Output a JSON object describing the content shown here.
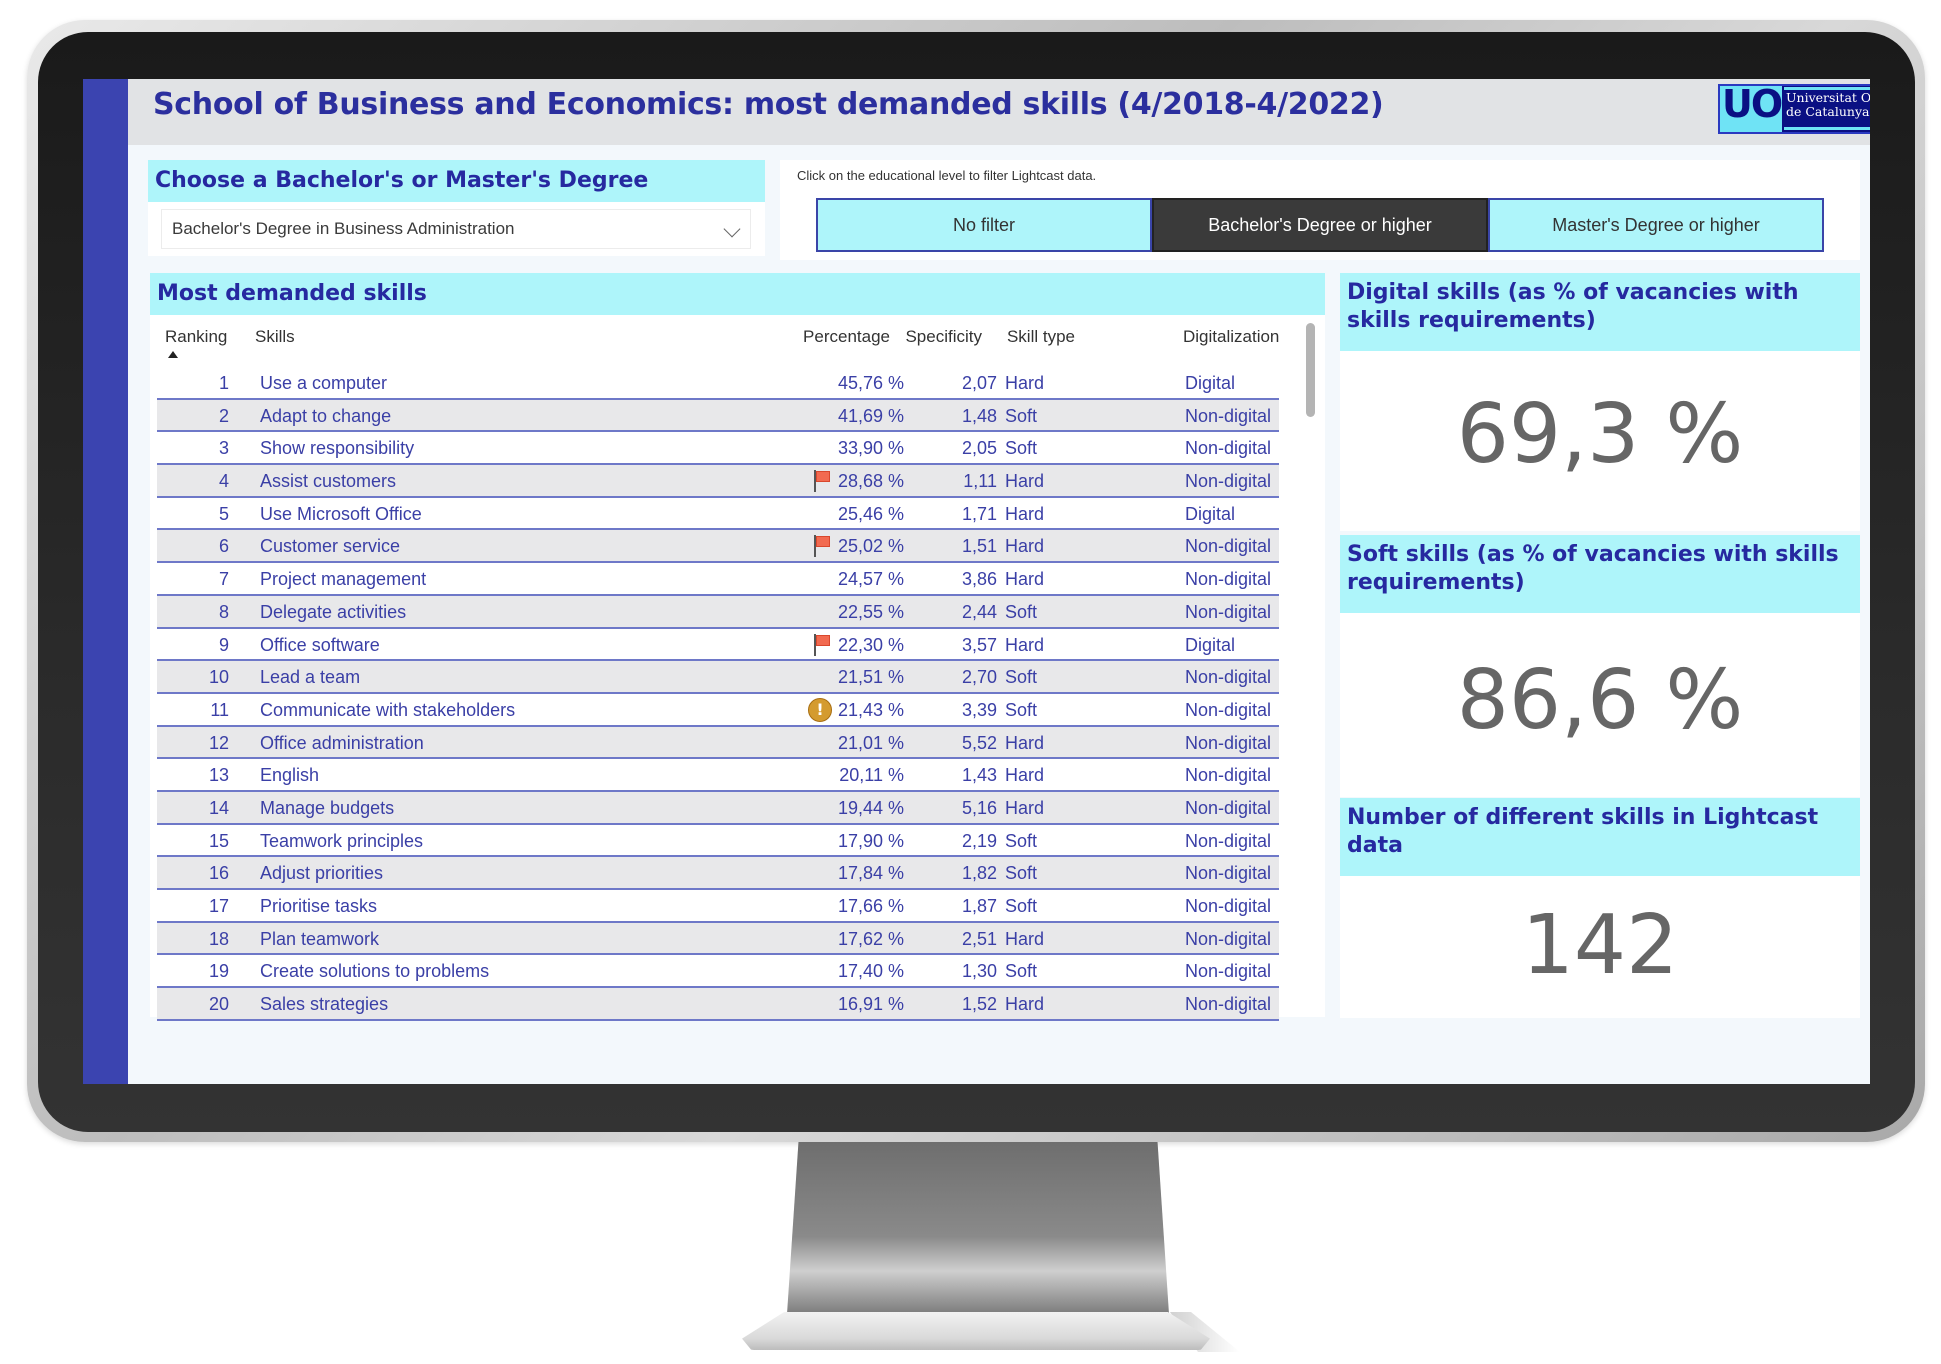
{
  "header": {
    "title": "School of Business and Economics: most demanded skills (4/2018-4/2022)",
    "logo": {
      "mark": "UOC",
      "line1": "Universitat Oberta",
      "line2": "de Catalunya"
    }
  },
  "degree_selector": {
    "heading": "Choose a Bachelor's or Master's Degree",
    "selected": "Bachelor's Degree in Business Administration"
  },
  "filter": {
    "hint": "Click on the educational level to filter Lightcast data.",
    "buttons": [
      {
        "label": "No filter",
        "active": false
      },
      {
        "label": "Bachelor's Degree or higher",
        "active": true
      },
      {
        "label": "Master's Degree or higher",
        "active": false
      }
    ]
  },
  "skills_table": {
    "heading": "Most demanded skills",
    "columns": {
      "ranking": "Ranking",
      "skills": "Skills",
      "percentage": "Percentage",
      "specificity": "Specificity",
      "skill_type": "Skill type",
      "digitalization": "Digitalization"
    },
    "sort": {
      "column": "Ranking",
      "direction": "ascending"
    },
    "rows": [
      {
        "rank": "1",
        "skill": "Use a computer",
        "marker": "",
        "percentage": "45,76 %",
        "specificity": "2,07",
        "type": "Hard",
        "digitalization": "Digital"
      },
      {
        "rank": "2",
        "skill": "Adapt to change",
        "marker": "",
        "percentage": "41,69 %",
        "specificity": "1,48",
        "type": "Soft",
        "digitalization": "Non-digital"
      },
      {
        "rank": "3",
        "skill": "Show responsibility",
        "marker": "",
        "percentage": "33,90 %",
        "specificity": "2,05",
        "type": "Soft",
        "digitalization": "Non-digital"
      },
      {
        "rank": "4",
        "skill": "Assist customers",
        "marker": "flag",
        "percentage": "28,68 %",
        "specificity": "1,11",
        "type": "Hard",
        "digitalization": "Non-digital"
      },
      {
        "rank": "5",
        "skill": "Use Microsoft Office",
        "marker": "",
        "percentage": "25,46 %",
        "specificity": "1,71",
        "type": "Hard",
        "digitalization": "Digital"
      },
      {
        "rank": "6",
        "skill": "Customer service",
        "marker": "flag",
        "percentage": "25,02 %",
        "specificity": "1,51",
        "type": "Hard",
        "digitalization": "Non-digital"
      },
      {
        "rank": "7",
        "skill": "Project management",
        "marker": "",
        "percentage": "24,57 %",
        "specificity": "3,86",
        "type": "Hard",
        "digitalization": "Non-digital"
      },
      {
        "rank": "8",
        "skill": "Delegate activities",
        "marker": "",
        "percentage": "22,55 %",
        "specificity": "2,44",
        "type": "Soft",
        "digitalization": "Non-digital"
      },
      {
        "rank": "9",
        "skill": "Office software",
        "marker": "flag",
        "percentage": "22,30 %",
        "specificity": "3,57",
        "type": "Hard",
        "digitalization": "Digital"
      },
      {
        "rank": "10",
        "skill": "Lead a team",
        "marker": "",
        "percentage": "21,51 %",
        "specificity": "2,70",
        "type": "Soft",
        "digitalization": "Non-digital"
      },
      {
        "rank": "11",
        "skill": "Communicate with stakeholders",
        "marker": "warning",
        "percentage": "21,43 %",
        "specificity": "3,39",
        "type": "Soft",
        "digitalization": "Non-digital"
      },
      {
        "rank": "12",
        "skill": "Office administration",
        "marker": "",
        "percentage": "21,01 %",
        "specificity": "5,52",
        "type": "Hard",
        "digitalization": "Non-digital"
      },
      {
        "rank": "13",
        "skill": "English",
        "marker": "",
        "percentage": "20,11 %",
        "specificity": "1,43",
        "type": "Hard",
        "digitalization": "Non-digital"
      },
      {
        "rank": "14",
        "skill": "Manage budgets",
        "marker": "",
        "percentage": "19,44 %",
        "specificity": "5,16",
        "type": "Hard",
        "digitalization": "Non-digital"
      },
      {
        "rank": "15",
        "skill": "Teamwork principles",
        "marker": "",
        "percentage": "17,90 %",
        "specificity": "2,19",
        "type": "Soft",
        "digitalization": "Non-digital"
      },
      {
        "rank": "16",
        "skill": "Adjust priorities",
        "marker": "",
        "percentage": "17,84 %",
        "specificity": "1,82",
        "type": "Soft",
        "digitalization": "Non-digital"
      },
      {
        "rank": "17",
        "skill": "Prioritise tasks",
        "marker": "",
        "percentage": "17,66 %",
        "specificity": "1,87",
        "type": "Soft",
        "digitalization": "Non-digital"
      },
      {
        "rank": "18",
        "skill": "Plan teamwork",
        "marker": "",
        "percentage": "17,62 %",
        "specificity": "2,51",
        "type": "Hard",
        "digitalization": "Non-digital"
      },
      {
        "rank": "19",
        "skill": "Create solutions to problems",
        "marker": "",
        "percentage": "17,40 %",
        "specificity": "1,30",
        "type": "Soft",
        "digitalization": "Non-digital"
      },
      {
        "rank": "20",
        "skill": "Sales strategies",
        "marker": "",
        "percentage": "16,91 %",
        "specificity": "1,52",
        "type": "Hard",
        "digitalization": "Non-digital"
      }
    ]
  },
  "kpis": [
    {
      "label": "Digital skills (as % of vacancies with skills requirements)",
      "value": "69,3 %"
    },
    {
      "label": "Soft skills (as % of vacancies with skills requirements)",
      "value": "86,6 %"
    },
    {
      "label": "Number of different skills in Lightcast data",
      "value": "142"
    }
  ],
  "colors": {
    "accent_blue": "#2b2f9e",
    "sidebar_blue": "#3b44b0",
    "band_cyan": "#aef5fa",
    "active_button": "#3a3a3a",
    "flag_red": "#f26a50",
    "warning_amber": "#d49b2f"
  }
}
